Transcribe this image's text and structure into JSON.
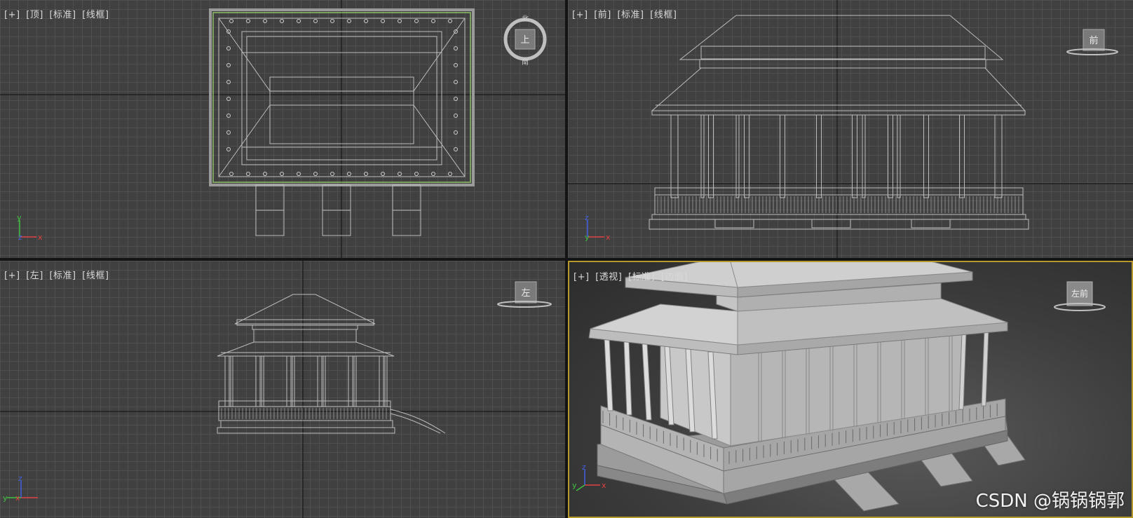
{
  "viewports": {
    "top": {
      "labels": [
        "[+]",
        "[顶]",
        "[标准]",
        "[线框]"
      ],
      "compass": {
        "north": "北",
        "south": "南",
        "face": "上"
      }
    },
    "front": {
      "labels": [
        "[+]",
        "[前]",
        "[标准]",
        "[线框]"
      ],
      "cube_face": "前"
    },
    "left": {
      "labels": [
        "[+]",
        "[左]",
        "[标准]",
        "[线框]"
      ],
      "cube_face": "左"
    },
    "perspective": {
      "labels": [
        "[+]",
        "[透视]",
        "[标准]",
        "[边面]"
      ],
      "cube_face": "左前"
    }
  },
  "axes": {
    "x": "x",
    "y": "y",
    "z": "z"
  },
  "watermark": "CSDN @锅锅锅郭",
  "colors": {
    "grid_bg": "#404040",
    "grid_line": "#4f4f4f",
    "wire": "#bcbcbc",
    "active_border": "#b89a2c",
    "axis_x": "#e04040",
    "axis_y": "#40c040",
    "axis_z": "#4060e0"
  }
}
